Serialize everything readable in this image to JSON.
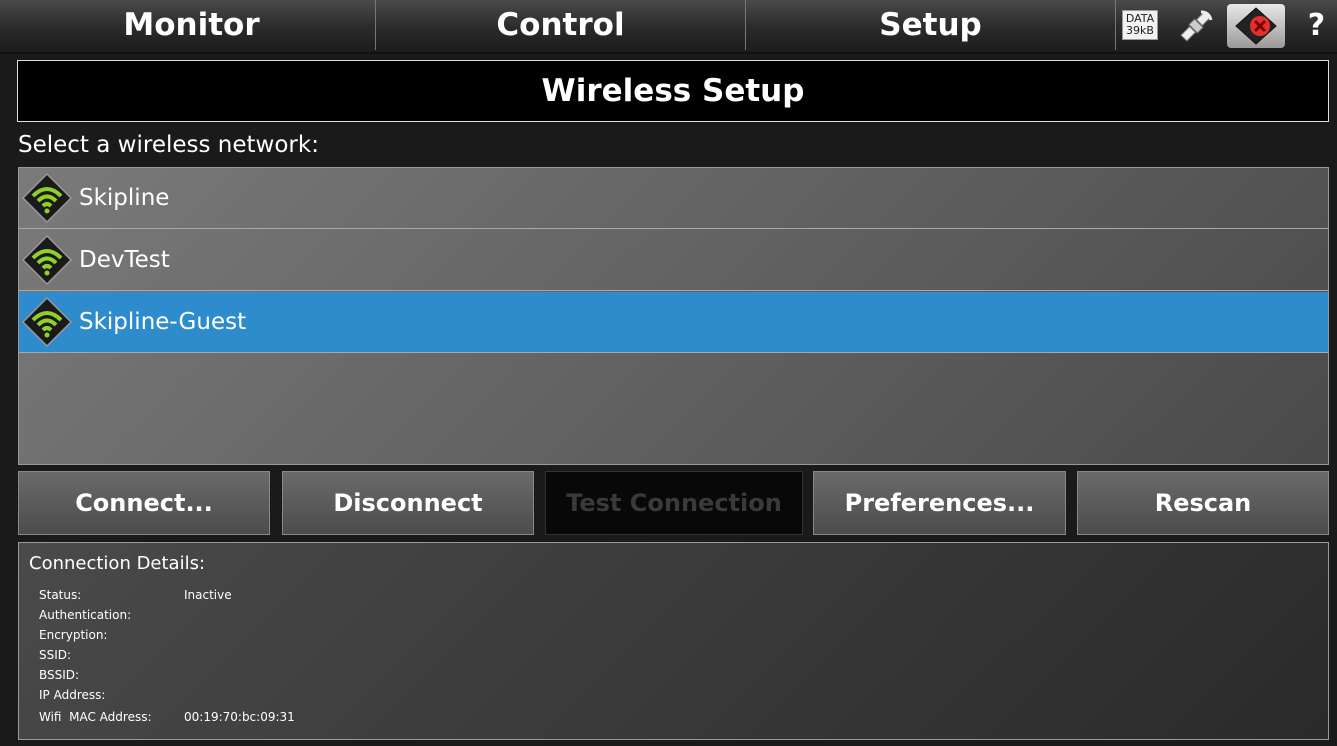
{
  "nav": {
    "tabs": [
      "Monitor",
      "Control",
      "Setup"
    ],
    "data_indicator": {
      "label": "DATA",
      "value": "39kB"
    },
    "help_label": "?"
  },
  "page": {
    "title": "Wireless Setup",
    "prompt": "Select a wireless network:"
  },
  "networks": [
    {
      "ssid": "Skipline",
      "selected": false
    },
    {
      "ssid": "DevTest",
      "selected": false
    },
    {
      "ssid": "Skipline-Guest",
      "selected": true
    }
  ],
  "buttons": {
    "connect": "Connect...",
    "disconnect": "Disconnect",
    "test": "Test Connection",
    "preferences": "Preferences...",
    "rescan": "Rescan"
  },
  "details": {
    "title": "Connection Details:",
    "rows": [
      {
        "label": "Status:",
        "value": "Inactive"
      },
      {
        "label": "Authentication:",
        "value": ""
      },
      {
        "label": "Encryption:",
        "value": ""
      },
      {
        "label": "SSID:",
        "value": ""
      },
      {
        "label": "BSSID:",
        "value": ""
      },
      {
        "label": "IP Address:",
        "value": ""
      },
      {
        "label": "Wifi  MAC Address:",
        "value": "00:19:70:bc:09:31"
      }
    ]
  },
  "colors": {
    "selection": "#2f8ccc",
    "signal_green": "#8fd12a",
    "status_error": "#e53030"
  },
  "icons": [
    "gps-satellite-icon",
    "connection-error-icon",
    "wifi-signal-icon"
  ]
}
